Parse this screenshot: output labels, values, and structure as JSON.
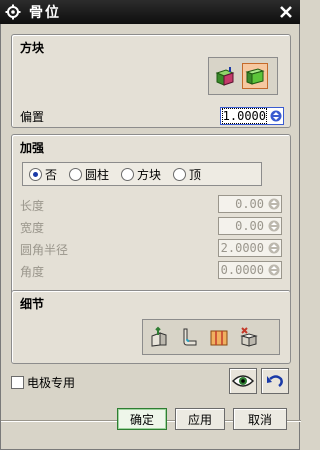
{
  "window": {
    "title": "骨位"
  },
  "block_section": {
    "title": "方块",
    "offset_label": "偏置",
    "offset_value": "1.0000"
  },
  "reinforce_section": {
    "title": "加强",
    "options": [
      "否",
      "圆柱",
      "方块",
      "顶"
    ],
    "selected": "否",
    "fields": [
      {
        "label": "长度",
        "value": "0.00"
      },
      {
        "label": "宽度",
        "value": "0.00"
      },
      {
        "label": "圆角半径",
        "value": "2.0000"
      },
      {
        "label": "角度",
        "value": "0.0000"
      }
    ]
  },
  "detail_section": {
    "title": "细节"
  },
  "electrode_only_label": "电极专用",
  "buttons": {
    "ok": "确定",
    "apply": "应用",
    "cancel": "取消"
  },
  "colors": {
    "titlebar": "#151515",
    "panel": "#e4e0d6",
    "accent_orange": "#c46a2a",
    "green": "#2e7d32"
  }
}
